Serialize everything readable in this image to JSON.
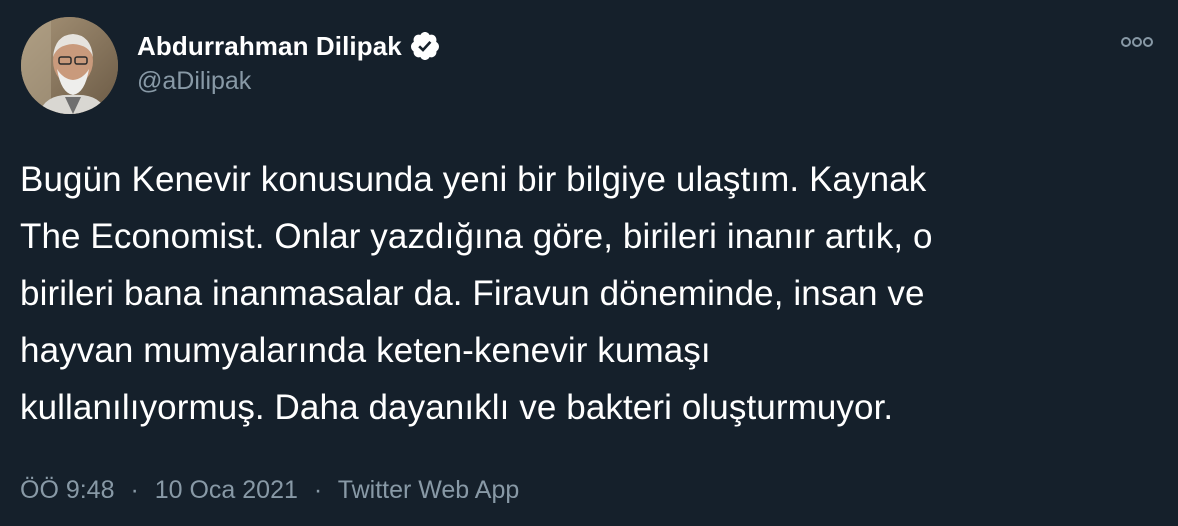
{
  "user": {
    "display_name": "Abdurrahman Dilipak",
    "handle": "@aDilipak",
    "verified": true,
    "avatar_icon": "profile-photo"
  },
  "tweet": {
    "lines": [
      "Bugün Kenevir konusunda yeni bir bilgiye ulaştım. Kaynak",
      "The Economist. Onlar yazdığına göre, birileri inanır artık, o",
      "birileri bana inanmasalar da. Firavun döneminde, insan ve",
      "hayvan mumyalarında keten-kenevir kumaşı",
      "kullanılıyormuş. Daha dayanıklı ve bakteri oluşturmuyor."
    ]
  },
  "meta": {
    "time": "ÖÖ 9:48",
    "separator": "·",
    "date": "10 Oca 2021",
    "source": "Twitter Web App"
  },
  "icons": {
    "verified": "verified-badge-icon",
    "more": "more-options-icon"
  },
  "colors": {
    "background": "#15202b",
    "primary_text": "#ffffff",
    "secondary_text": "#8899a6"
  }
}
